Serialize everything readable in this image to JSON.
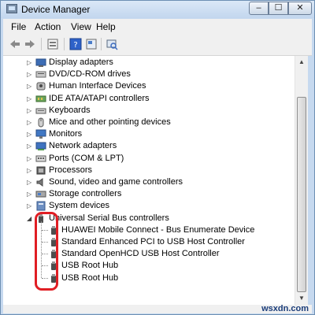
{
  "window": {
    "title": "Device Manager",
    "minimize_glyph": "–",
    "maximize_glyph": "☐",
    "close_glyph": "✕"
  },
  "menubar": {
    "items": [
      "File",
      "Action",
      "View",
      "Help"
    ]
  },
  "toolbar": {
    "buttons": [
      "back-arrow-icon",
      "forward-arrow-icon",
      "properties-icon",
      "help-icon",
      "device-properties-icon",
      "scan-hardware-icon"
    ]
  },
  "tree": {
    "categories": [
      {
        "label": "Display adapters",
        "icon": "display-adapter-icon"
      },
      {
        "label": "DVD/CD-ROM drives",
        "icon": "dvd-drive-icon"
      },
      {
        "label": "Human Interface Devices",
        "icon": "hid-icon"
      },
      {
        "label": "IDE ATA/ATAPI controllers",
        "icon": "ide-controller-icon"
      },
      {
        "label": "Keyboards",
        "icon": "keyboard-icon"
      },
      {
        "label": "Mice and other pointing devices",
        "icon": "mouse-icon"
      },
      {
        "label": "Monitors",
        "icon": "monitor-icon"
      },
      {
        "label": "Network adapters",
        "icon": "network-adapter-icon"
      },
      {
        "label": "Ports (COM & LPT)",
        "icon": "port-icon"
      },
      {
        "label": "Processors",
        "icon": "processor-icon"
      },
      {
        "label": "Sound, video and game controllers",
        "icon": "sound-icon"
      },
      {
        "label": "Storage controllers",
        "icon": "storage-icon"
      },
      {
        "label": "System devices",
        "icon": "system-device-icon"
      },
      {
        "label": "Universal Serial Bus controllers",
        "icon": "usb-controller-icon"
      }
    ],
    "usb_children": [
      "HUAWEI Mobile Connect - Bus Enumerate Device",
      "Standard Enhanced PCI to USB Host Controller",
      "Standard OpenHCD USB Host Controller",
      "USB Root Hub",
      "USB Root Hub"
    ],
    "expanded_glyph": "◢",
    "collapsed_glyph": "▷"
  },
  "scrollbar": {
    "up_glyph": "▲",
    "down_glyph": "▼"
  },
  "watermark": "wsxdn.com",
  "colors": {
    "annotation": "#e01e24",
    "titlebar": "#c2d6ee",
    "frame": "#c6d9ef"
  }
}
